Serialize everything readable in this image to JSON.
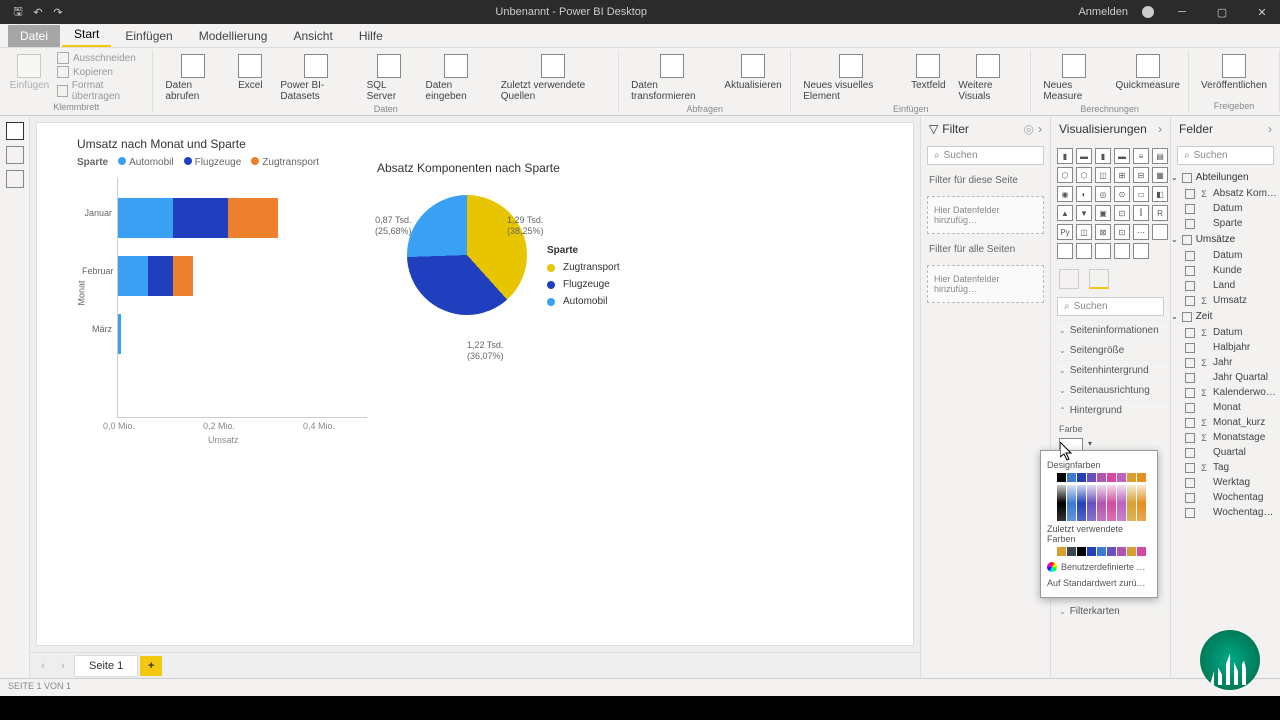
{
  "titlebar": {
    "title": "Unbenannt - Power BI Desktop",
    "signin": "Anmelden"
  },
  "tabs": {
    "file": "Datei",
    "start": "Start",
    "insert": "Einfügen",
    "model": "Modellierung",
    "view": "Ansicht",
    "help": "Hilfe"
  },
  "ribbon": {
    "clipboard": {
      "paste": "Einfügen",
      "cut": "Ausschneiden",
      "copy": "Kopieren",
      "format": "Format übertragen",
      "group": "Klemmbrett"
    },
    "data": {
      "getdata": "Daten abrufen",
      "excel": "Excel",
      "pbi": "Power BI-Datasets",
      "sql": "SQL Server",
      "enter": "Daten eingeben",
      "recent": "Zuletzt verwendete Quellen",
      "group": "Daten"
    },
    "queries": {
      "transform": "Daten transformieren",
      "refresh": "Aktualisieren",
      "group": "Abfragen"
    },
    "insert": {
      "visual": "Neues visuelles Element",
      "textbox": "Textfeld",
      "more": "Weitere Visuals",
      "group": "Einfügen"
    },
    "calc": {
      "measure": "Neues Measure",
      "quick": "Quickmeasure",
      "group": "Berechnungen"
    },
    "share": {
      "publish": "Veröffentlichen",
      "group": "Freigeben"
    }
  },
  "chart_data": [
    {
      "type": "bar",
      "title": "Umsatz nach Monat und Sparte",
      "legend_title": "Sparte",
      "series": [
        {
          "name": "Automobil",
          "color": "#3aa0f3"
        },
        {
          "name": "Flugzeuge",
          "color": "#1f3fbf"
        },
        {
          "name": "Zugtransport",
          "color": "#ee7f2d"
        }
      ],
      "categories": [
        "Januar",
        "Februar",
        "März"
      ],
      "stacked_values": {
        "Januar": {
          "Automobil": 0.11,
          "Flugzeuge": 0.11,
          "Zugtransport": 0.1
        },
        "Februar": {
          "Automobil": 0.06,
          "Flugzeuge": 0.05,
          "Zugtransport": 0.04
        },
        "März": {
          "Automobil": 0.005,
          "Flugzeuge": 0.0,
          "Zugtransport": 0.0
        }
      },
      "xlabel": "Umsatz",
      "ylabel": "Monat",
      "xticks": [
        "0,0 Mio.",
        "0,2 Mio.",
        "0,4 Mio."
      ],
      "xlim": [
        0,
        0.4
      ]
    },
    {
      "type": "pie",
      "title": "Absatz Komponenten nach Sparte",
      "legend_title": "Sparte",
      "slices": [
        {
          "name": "Zugtransport",
          "value": 1290,
          "pct": 38.25,
          "label": "1,29 Tsd.",
          "pct_label": "(38,25%)",
          "color": "#e7c500"
        },
        {
          "name": "Flugzeuge",
          "value": 1220,
          "pct": 36.07,
          "label": "1,22 Tsd.",
          "pct_label": "(36,07%)",
          "color": "#1f3fbf"
        },
        {
          "name": "Automobil",
          "value": 870,
          "pct": 25.68,
          "label": "0,87 Tsd.",
          "pct_label": "(25,68%)",
          "color": "#3aa0f3"
        }
      ]
    }
  ],
  "pages": {
    "tab1": "Seite 1"
  },
  "filter": {
    "title": "Filter",
    "search": "Suchen",
    "thisPage": "Filter für diese Seite",
    "allPages": "Filter für alle Seiten",
    "drop": "Hier Datenfelder hinzufüg…"
  },
  "viz": {
    "title": "Visualisierungen",
    "search": "Suchen",
    "sections": {
      "pageinfo": "Seiteninformationen",
      "pagesize": "Seitengröße",
      "pagebg": "Seitenhintergrund",
      "align": "Seitenausrichtung",
      "bg": "Hintergrund",
      "filtercards": "Filterkarten"
    },
    "color_label": "Farbe"
  },
  "color_popup": {
    "design": "Designfarben",
    "recent": "Zuletzt verwendete Farben",
    "custom": "Benutzerdefinierte …",
    "reset": "Auf Standardwert zurü…",
    "colors_row": [
      "#ffffff",
      "#000000",
      "#3b7bd1",
      "#2640b8",
      "#6a4fc1",
      "#b254b2",
      "#d44aa0",
      "#c060c0",
      "#d8a030",
      "#e59020"
    ],
    "recent_colors": [
      "#ffffff",
      "#d8a030",
      "#3b444f",
      "#000000",
      "#2640b8",
      "#3b7bd1",
      "#6a4fc1",
      "#b254b2",
      "#d8a030",
      "#d44aa0"
    ]
  },
  "fields": {
    "title": "Felder",
    "search": "Suchen",
    "tables": [
      {
        "name": "Abteilungen",
        "items": [
          {
            "n": "Absatz Kom…",
            "s": true
          },
          {
            "n": "Datum"
          },
          {
            "n": "Sparte"
          }
        ]
      },
      {
        "name": "Umsätze",
        "items": [
          {
            "n": "Datum"
          },
          {
            "n": "Kunde"
          },
          {
            "n": "Land"
          },
          {
            "n": "Umsatz",
            "s": true
          }
        ]
      },
      {
        "name": "Zeit",
        "items": [
          {
            "n": "Datum",
            "s": true
          },
          {
            "n": "Halbjahr"
          },
          {
            "n": "Jahr",
            "s": true
          },
          {
            "n": "Jahr Quartal"
          },
          {
            "n": "Kalenderwo…",
            "s": true
          },
          {
            "n": "Monat"
          },
          {
            "n": "Monat_kurz",
            "s": true
          },
          {
            "n": "Monatstage",
            "s": true
          },
          {
            "n": "Quartal"
          },
          {
            "n": "Tag",
            "s": true
          },
          {
            "n": "Werktag"
          },
          {
            "n": "Wochentag"
          },
          {
            "n": "Wochentag…"
          }
        ]
      }
    ]
  },
  "status": "SEITE 1 VON 1"
}
